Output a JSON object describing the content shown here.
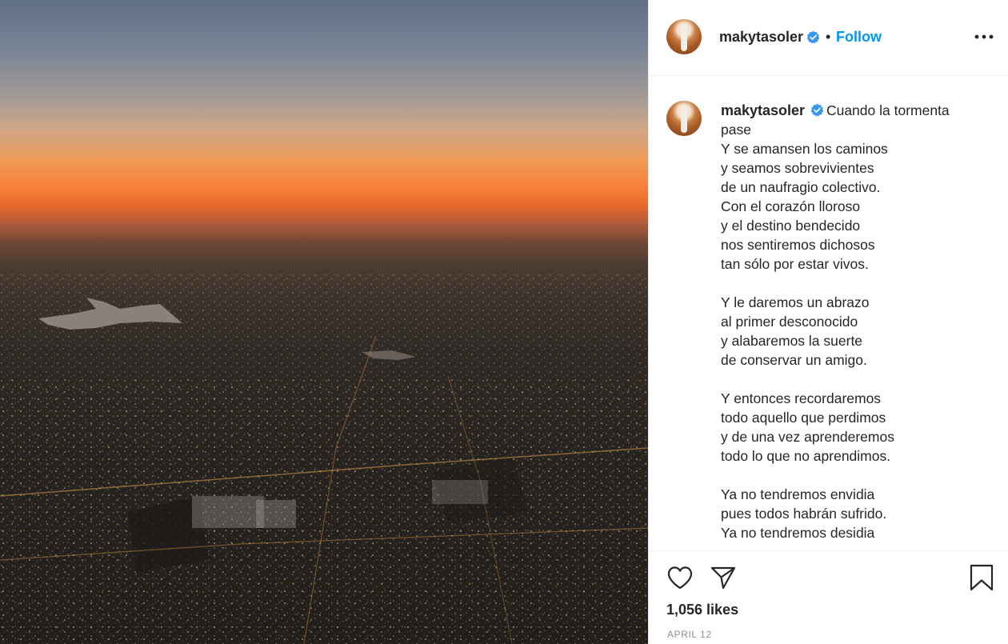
{
  "post": {
    "image_alt": "Aerial view of a city at sunset",
    "username": "makytasoler",
    "verified": true,
    "separator": "•",
    "follow_label": "Follow",
    "caption_first_line": "Cuando la tormenta pase",
    "caption_body": "Y se amansen los caminos\ny seamos sobrevivientes\nde un naufragio colectivo.\nCon el corazón lloroso\ny el destino bendecido\nnos sentiremos dichosos\ntan sólo por estar vivos.\n\nY le daremos un abrazo\nal primer desconocido\ny alabaremos la suerte\nde conservar un amigo.\n\nY entonces recordaremos\ntodo aquello que perdimos\ny de una vez aprenderemos\ntodo lo que no aprendimos.\n\nYa no tendremos envidia\npues todos habrán sufrido.\nYa no tendremos desidia",
    "likes": "1,056 likes",
    "date": "APRIL 12"
  },
  "icons": {
    "verified": "verified-badge-icon",
    "more": "more-options-icon",
    "like": "heart-icon",
    "share": "send-icon",
    "save": "bookmark-icon"
  },
  "colors": {
    "accent": "#0095f6",
    "text": "#262626",
    "muted": "#8e8e8e",
    "verified": "#3897f0"
  }
}
